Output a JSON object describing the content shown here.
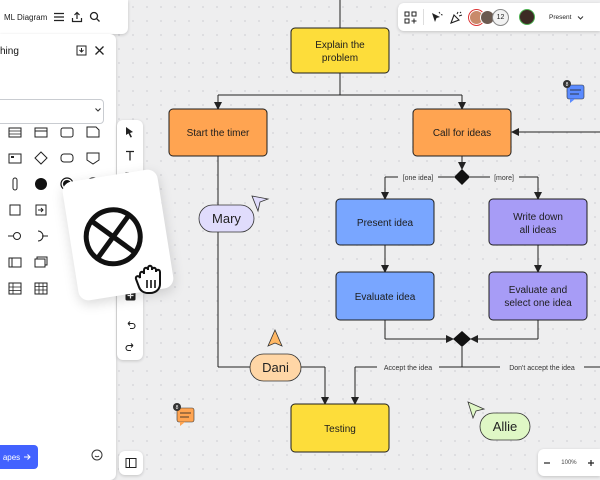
{
  "app": {
    "title": "ML Diagram",
    "present_label": "Present",
    "collaborator_count": "12",
    "zoom_level": "100%"
  },
  "library": {
    "title": "hing",
    "button_label": "apes"
  },
  "colors": {
    "yellow": "#fddd3a",
    "orange": "#ffa451",
    "blue": "#79a6ff",
    "purple": "#a79cf6",
    "lavender": "#e0dcfc",
    "peach": "#ffd6a6",
    "mint": "#dff7c5",
    "accent": "#4262ff"
  },
  "diagram": {
    "nodes": {
      "explain": "Explain the\nproblem",
      "timer": "Start the timer",
      "ideas": "Call for ideas",
      "present": "Present idea",
      "write": "Write down\nall ideas",
      "eval_idea": "Evaluate idea",
      "eval_select": "Evaluate and\nselect one idea",
      "testing": "Testing"
    },
    "edge_labels": {
      "one_idea": "[one idea]",
      "more": "[more]",
      "accept": "Accept the idea",
      "dont_accept": "Don't accept the idea"
    }
  },
  "cursors": {
    "mary": "Mary",
    "dani": "Dani",
    "allie": "Allie"
  },
  "comments": {
    "top_count": "8",
    "bottom_count": "8"
  }
}
